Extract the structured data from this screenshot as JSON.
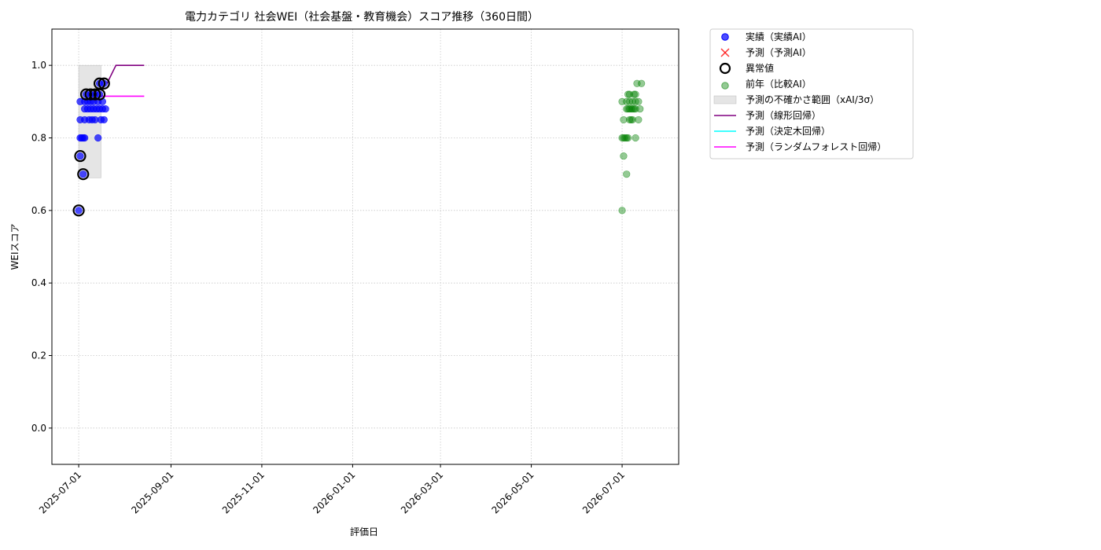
{
  "chart_data": {
    "type": "scatter",
    "title": "電力カテゴリ 社会WEI（社会基盤・教育機会）スコア推移（360日間）",
    "xlabel": "評価日",
    "ylabel": "WEIスコア",
    "ylim": [
      -0.1,
      1.1
    ],
    "xlim": [
      "2025-06-13",
      "2026-08-08"
    ],
    "grid": true,
    "legend_position": "outside-right-top",
    "xticks": [
      "2025-07-01",
      "2025-09-01",
      "2025-11-01",
      "2026-01-01",
      "2026-03-01",
      "2026-05-01",
      "2026-07-01"
    ],
    "yticks": [
      0.0,
      0.2,
      0.4,
      0.6,
      0.8,
      1.0
    ],
    "ytick_labels": [
      "0.0",
      "0.2",
      "0.4",
      "0.6",
      "0.8",
      "1.0"
    ],
    "legend": [
      "実績（実績AI）",
      "予測（予測AI）",
      "異常値",
      "前年（比較AI）",
      "予測の不確かさ範囲（xAI/3σ）",
      "予測（線形回帰）",
      "予測（決定木回帰）",
      "予測（ランダムフォレスト回帰）"
    ],
    "colors": {
      "actual": "#0000ff",
      "forecast": "#ff0000",
      "anomaly": "#000000",
      "previous_year": "#008000",
      "uncertainty": "#d3d3d3",
      "linear": "#800080",
      "tree": "#00ffff",
      "forest": "#ff00ff"
    },
    "series": [
      {
        "name": "実績（実績AI）",
        "marker": "circle",
        "points": [
          [
            "2025-07-01",
            0.6
          ],
          [
            "2025-07-02",
            0.75
          ],
          [
            "2025-07-04",
            0.7
          ],
          [
            "2025-07-02",
            0.8
          ],
          [
            "2025-07-03",
            0.8
          ],
          [
            "2025-07-04",
            0.8
          ],
          [
            "2025-07-05",
            0.8
          ],
          [
            "2025-07-14",
            0.8
          ],
          [
            "2025-07-02",
            0.85
          ],
          [
            "2025-07-05",
            0.85
          ],
          [
            "2025-07-08",
            0.85
          ],
          [
            "2025-07-10",
            0.85
          ],
          [
            "2025-07-12",
            0.85
          ],
          [
            "2025-07-16",
            0.85
          ],
          [
            "2025-07-18",
            0.85
          ],
          [
            "2025-07-05",
            0.88
          ],
          [
            "2025-07-07",
            0.88
          ],
          [
            "2025-07-09",
            0.88
          ],
          [
            "2025-07-11",
            0.88
          ],
          [
            "2025-07-13",
            0.88
          ],
          [
            "2025-07-15",
            0.88
          ],
          [
            "2025-07-17",
            0.88
          ],
          [
            "2025-07-19",
            0.88
          ],
          [
            "2025-07-02",
            0.9
          ],
          [
            "2025-07-05",
            0.9
          ],
          [
            "2025-07-07",
            0.9
          ],
          [
            "2025-07-09",
            0.9
          ],
          [
            "2025-07-11",
            0.9
          ],
          [
            "2025-07-14",
            0.9
          ],
          [
            "2025-07-17",
            0.9
          ],
          [
            "2025-07-06",
            0.92
          ],
          [
            "2025-07-09",
            0.92
          ],
          [
            "2025-07-12",
            0.92
          ],
          [
            "2025-07-15",
            0.92
          ],
          [
            "2025-07-15",
            0.95
          ],
          [
            "2025-07-18",
            0.95
          ]
        ]
      },
      {
        "name": "異常値",
        "marker": "ring",
        "points": [
          [
            "2025-07-01",
            0.6
          ],
          [
            "2025-07-02",
            0.75
          ],
          [
            "2025-07-04",
            0.7
          ],
          [
            "2025-07-06",
            0.92
          ],
          [
            "2025-07-09",
            0.92
          ],
          [
            "2025-07-12",
            0.92
          ],
          [
            "2025-07-15",
            0.92
          ],
          [
            "2025-07-15",
            0.95
          ],
          [
            "2025-07-18",
            0.95
          ]
        ]
      },
      {
        "name": "前年（比較AI）",
        "marker": "circle",
        "points": [
          [
            "2026-07-01",
            0.6
          ],
          [
            "2026-07-02",
            0.75
          ],
          [
            "2026-07-04",
            0.7
          ],
          [
            "2026-07-01",
            0.8
          ],
          [
            "2026-07-02",
            0.8
          ],
          [
            "2026-07-03",
            0.8
          ],
          [
            "2026-07-04",
            0.8
          ],
          [
            "2026-07-05",
            0.8
          ],
          [
            "2026-07-10",
            0.8
          ],
          [
            "2026-07-02",
            0.85
          ],
          [
            "2026-07-06",
            0.85
          ],
          [
            "2026-07-07",
            0.85
          ],
          [
            "2026-07-08",
            0.85
          ],
          [
            "2026-07-12",
            0.85
          ],
          [
            "2026-07-04",
            0.88
          ],
          [
            "2026-07-05",
            0.88
          ],
          [
            "2026-07-06",
            0.88
          ],
          [
            "2026-07-07",
            0.88
          ],
          [
            "2026-07-08",
            0.88
          ],
          [
            "2026-07-09",
            0.88
          ],
          [
            "2026-07-10",
            0.88
          ],
          [
            "2026-07-13",
            0.88
          ],
          [
            "2026-07-01",
            0.9
          ],
          [
            "2026-07-04",
            0.9
          ],
          [
            "2026-07-06",
            0.9
          ],
          [
            "2026-07-08",
            0.9
          ],
          [
            "2026-07-10",
            0.9
          ],
          [
            "2026-07-12",
            0.9
          ],
          [
            "2026-07-05",
            0.92
          ],
          [
            "2026-07-06",
            0.92
          ],
          [
            "2026-07-09",
            0.92
          ],
          [
            "2026-07-10",
            0.92
          ],
          [
            "2026-07-11",
            0.95
          ],
          [
            "2026-07-14",
            0.95
          ]
        ]
      },
      {
        "name": "予測（線形回帰）",
        "marker": "line",
        "points": [
          [
            "2025-07-20",
            0.95
          ],
          [
            "2025-07-23",
            0.975
          ],
          [
            "2025-07-26",
            1.0
          ],
          [
            "2025-08-14",
            1.0
          ]
        ]
      },
      {
        "name": "予測（ランダムフォレスト回帰）",
        "marker": "line",
        "points": [
          [
            "2025-07-16",
            0.915
          ],
          [
            "2025-08-14",
            0.915
          ]
        ]
      }
    ],
    "uncertainty_band": {
      "x": [
        "2025-07-01",
        "2025-07-16"
      ],
      "y": [
        0.69,
        1.0
      ]
    }
  }
}
